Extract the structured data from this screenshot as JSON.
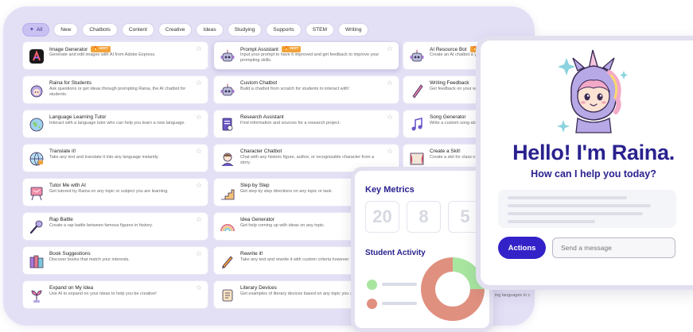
{
  "filters": [
    {
      "label": "All",
      "active": true
    },
    {
      "label": "New"
    },
    {
      "label": "Chatbots"
    },
    {
      "label": "Content"
    },
    {
      "label": "Creative"
    },
    {
      "label": "Ideas"
    },
    {
      "label": "Studying"
    },
    {
      "label": "Supports"
    },
    {
      "label": "STEM"
    },
    {
      "label": "Writing"
    }
  ],
  "hot_badge": "HOT",
  "tools": {
    "col1": [
      {
        "title": "Image Generator",
        "hot": true,
        "desc": "Generate and edit images with AI from Adobe Express.",
        "icon": "adobe-express-icon"
      },
      {
        "title": "Raina for Students",
        "desc": "Ask questions or get ideas through prompting Raina, the AI chatbot for students.",
        "icon": "raina-icon"
      },
      {
        "title": "Language Learning Tutor",
        "desc": "Interact with a language tutor who can help you learn a new language.",
        "icon": "globe-icon"
      },
      {
        "title": "Translate it!",
        "desc": "Take any text and translate it into any language instantly.",
        "icon": "globe-translate-icon"
      },
      {
        "title": "Tutor Me with AI",
        "desc": "Get tutored by Raina on any topic or subject you are learning.",
        "icon": "board-icon"
      },
      {
        "title": "Rap Battle",
        "desc": "Create a rap battle between famous figures in history.",
        "icon": "microphone-icon"
      },
      {
        "title": "Book Suggestions",
        "desc": "Discover books that match your interests.",
        "icon": "books-icon"
      },
      {
        "title": "Expand on My Idea",
        "desc": "Use AI to expand on your ideas to help you be creative!",
        "icon": "plant-icon"
      }
    ],
    "col2": [
      {
        "title": "Prompt Assistant",
        "hot": true,
        "desc": "Input your prompt to have it improved and get feedback to improve your prompting skills.",
        "icon": "robot-icon"
      },
      {
        "title": "Custom Chatbot",
        "desc": "Build a chatbot from scratch for students to interact with!",
        "icon": "robot-icon"
      },
      {
        "title": "Research Assistant",
        "desc": "Find information and sources for a research project.",
        "icon": "document-search-icon"
      },
      {
        "title": "Character Chatbot",
        "desc": "Chat with any historic figure, author, or recognizable character from a story.",
        "icon": "character-icon"
      },
      {
        "title": "Step by Step",
        "desc": "Get step by step directions on any topic or task.",
        "icon": "steps-icon"
      },
      {
        "title": "Idea Generator",
        "desc": "Get help coming up with ideas on any topic.",
        "icon": "rainbow-icon"
      },
      {
        "title": "Rewrite it!",
        "desc": "Take any text and rewrite it with custom criteria however",
        "icon": "pencil-icon"
      },
      {
        "title": "Literary Devices",
        "desc": "Get examples of literary devices based on any topic you are writing.",
        "icon": "scroll-icon"
      }
    ],
    "col3": [
      {
        "title": "AI Resource Bot",
        "hot": true,
        "desc": "Create an AI chatbot a your instructions!",
        "icon": "robot-icon"
      },
      {
        "title": "Writing Feedback",
        "desc": "Get feedback on your w",
        "icon": "pen-icon"
      },
      {
        "title": "Song Generator",
        "desc": "Write a custom song ab your choice!",
        "icon": "music-note-icon"
      },
      {
        "title": "Create a Skit!",
        "desc": "Create a skit for class o",
        "icon": "theater-icon"
      }
    ],
    "peek_text": "ing languages in c"
  },
  "chat": {
    "greeting": "Hello! I'm Raina.",
    "subtitle": "How can I help you today?",
    "actions_label": "Actions",
    "input_placeholder": "Send a message"
  },
  "metrics": {
    "title": "Key Metrics",
    "values": [
      "20",
      "8",
      "5"
    ],
    "activity_title": "Student Activity",
    "legend_colors": [
      "#a8e6a0",
      "#e0907f"
    ]
  },
  "chart_data": {
    "type": "pie",
    "title": "Student Activity",
    "values": [
      25,
      75
    ],
    "colors": [
      "#a8e6a0",
      "#e0907f"
    ]
  }
}
